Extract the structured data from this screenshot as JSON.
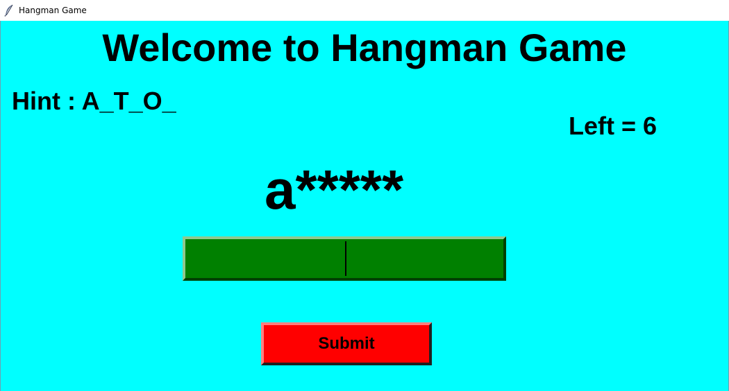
{
  "window": {
    "title": "Hangman Game",
    "icon": "feather-icon"
  },
  "colors": {
    "background": "#00ffff",
    "input_bg": "#008000",
    "submit_bg": "#ff0000"
  },
  "game": {
    "heading": "Welcome to Hangman Game",
    "hint": "Hint : A_T_O_",
    "left": "Left = 6",
    "masked_word": "a*****",
    "guess_value": "",
    "submit_label": "Submit"
  }
}
